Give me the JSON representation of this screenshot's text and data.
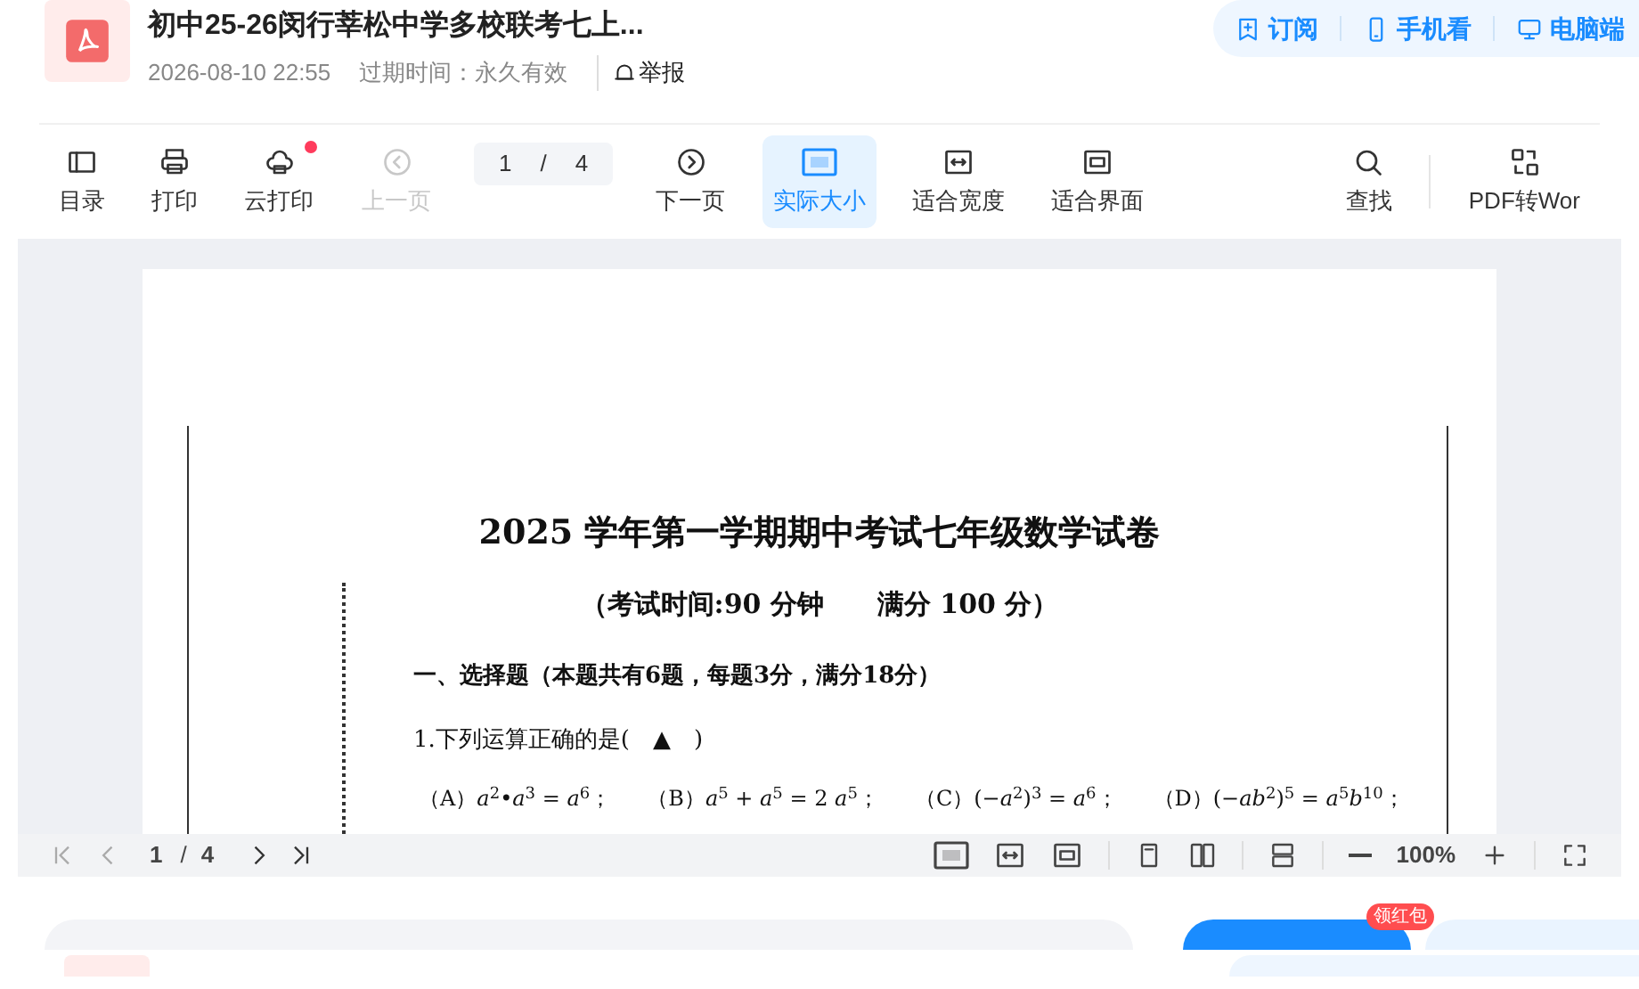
{
  "header": {
    "title": "初中25-26闵行莘松中学多校联考七上...",
    "date": "2026-08-10 22:55",
    "expiry": "过期时间：永久有效",
    "report": "举报"
  },
  "top_actions": [
    {
      "kind": "subscribe",
      "label": "订阅"
    },
    {
      "kind": "phone",
      "label": "手机看"
    },
    {
      "kind": "desktop",
      "label": "电脑端"
    }
  ],
  "toolbar": [
    {
      "kind": "toc",
      "label": "目录",
      "disabled": false,
      "selected": false,
      "dot": false
    },
    {
      "kind": "print",
      "label": "打印",
      "disabled": false,
      "selected": false,
      "dot": false
    },
    {
      "kind": "cloud",
      "label": "云打印",
      "disabled": false,
      "selected": false,
      "dot": true
    },
    {
      "kind": "prev",
      "label": "上一页",
      "disabled": true,
      "selected": false,
      "dot": false
    },
    {
      "kind": "pager",
      "current": "1",
      "sep": "/",
      "total": "4"
    },
    {
      "kind": "next",
      "label": "下一页",
      "disabled": false,
      "selected": false,
      "dot": false
    },
    {
      "kind": "actual",
      "label": "实际大小",
      "disabled": false,
      "selected": true,
      "dot": false
    },
    {
      "kind": "fitwidth",
      "label": "适合宽度",
      "disabled": false,
      "selected": false,
      "dot": false
    },
    {
      "kind": "fitpage",
      "label": "适合界面",
      "disabled": false,
      "selected": false,
      "dot": false
    },
    {
      "kind": "spacer"
    },
    {
      "kind": "search",
      "label": "查找",
      "disabled": false,
      "selected": false,
      "dot": false
    },
    {
      "kind": "divider"
    },
    {
      "kind": "convert",
      "label": "PDF转Wor",
      "disabled": false,
      "selected": false,
      "dot": false
    }
  ],
  "document": {
    "title": "2025 学年第一学期期中考试七年级数学试卷",
    "subtitle": "（考试时间:90 分钟　　满分 100 分）",
    "section": "一、选择题（本题共有6题，每题3分，满分18分）",
    "question": "1.下列运算正确的是(　▲　)",
    "options": [
      "（A）*a*$^{2}$•*a*$^{3}$ = *a*$^{6}$；",
      "（B）*a*$^{5}$ + *a*$^{5}$ = 2 *a*$^{5}$；",
      "（C）(−*a*$^{2}$)$^{3}$ = *a*$^{6}$；",
      "（D）(−*ab*$^{2}$)$^{5}$ = *a*$^{5}$*b*$^{10}$；"
    ]
  },
  "viewer_bar": {
    "current": "1",
    "sep": "/",
    "total": "4",
    "zoom": "100%"
  },
  "footer": {
    "badge": "领红包"
  }
}
